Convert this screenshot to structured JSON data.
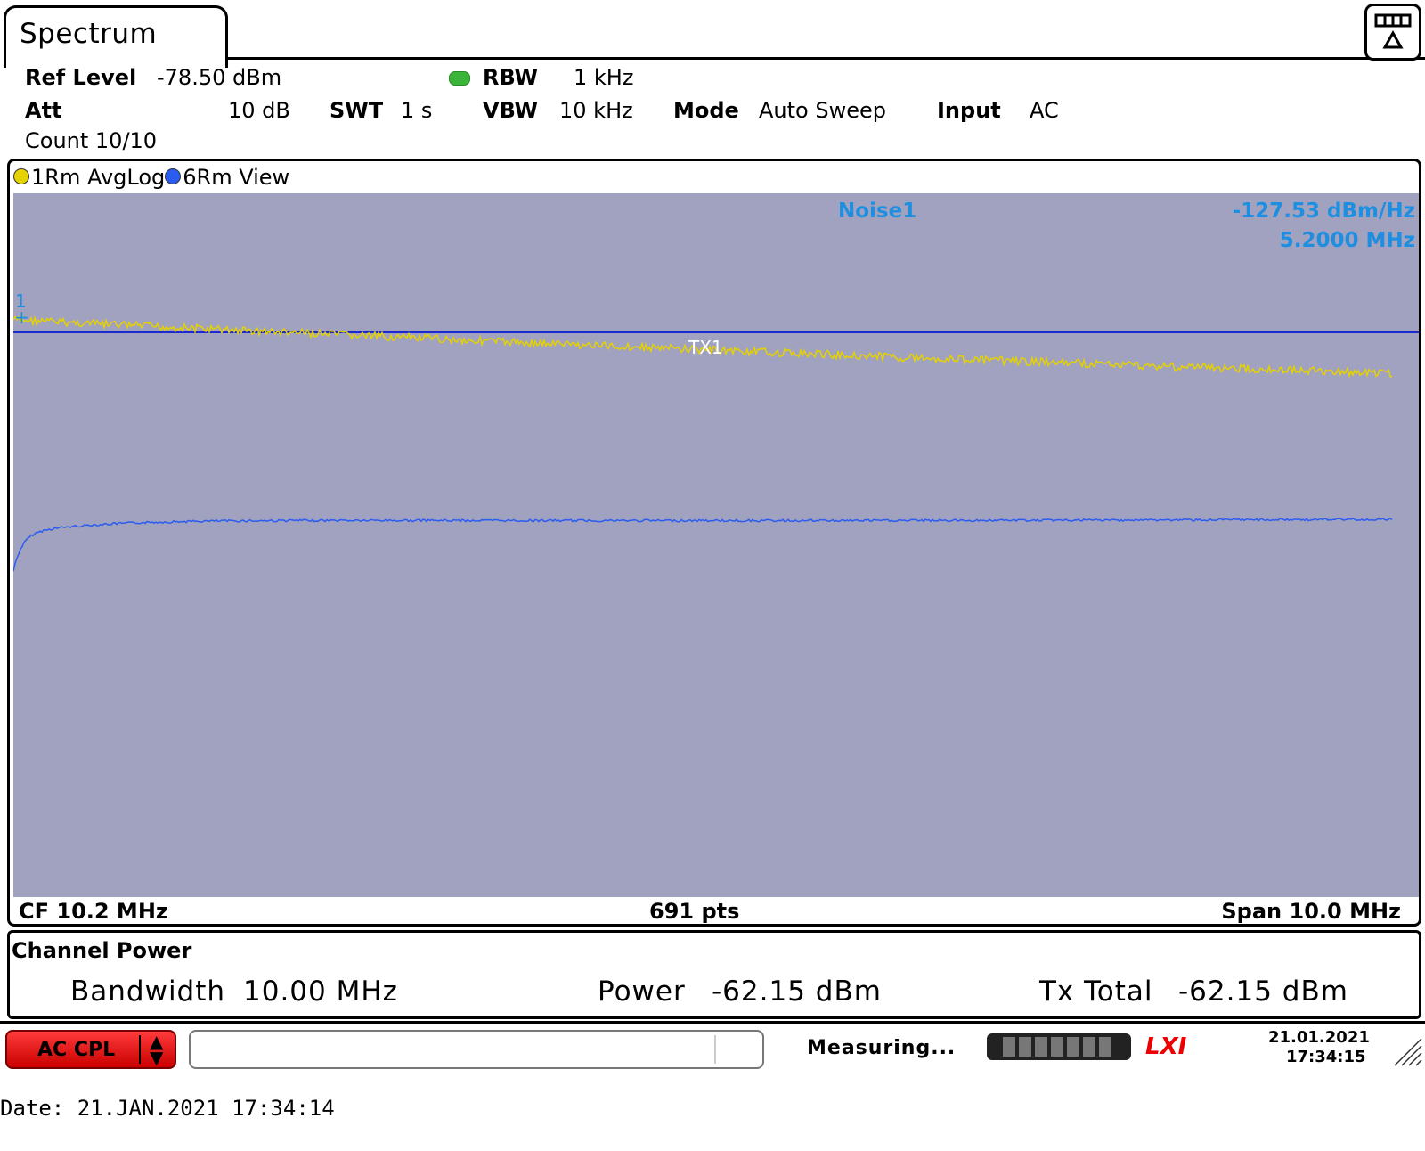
{
  "window": {
    "tab_title": "Spectrum"
  },
  "settings": {
    "ref_level_label": "Ref Level",
    "ref_level_value": "-78.50 dBm",
    "att_label": "Att",
    "att_value": "10 dB",
    "swt_label": "SWT",
    "swt_value": "1 s",
    "rbw_label": "RBW",
    "rbw_value": "1 kHz",
    "vbw_label": "VBW",
    "vbw_value": "10 kHz",
    "mode_label": "Mode",
    "mode_value": "Auto Sweep",
    "input_label": "Input",
    "input_value": "AC",
    "count": "Count 10/10"
  },
  "diagram": {
    "legend": [
      {
        "label": "1Rm AvgLog",
        "color": "#e6d200"
      },
      {
        "label": "6Rm View",
        "color": "#2a5cf0"
      }
    ],
    "marker_label": "Noise1",
    "marker_level": "-127.53 dBm/Hz",
    "marker_freq": "5.2000 MHz",
    "marker_number": "1",
    "channel_label": "TX1",
    "cf": "CF 10.2 MHz",
    "pts": "691 pts",
    "span": "Span 10.0 MHz",
    "colors": {
      "background": "#a0a2c0",
      "trace1": "#e6d200",
      "trace2": "#2a5cf0",
      "line": "#1a2ad0",
      "marker_text": "#1e8fe0"
    }
  },
  "channel_power": {
    "title": "Channel Power",
    "bandwidth_label": "Bandwidth",
    "bandwidth_value": "10.00 MHz",
    "power_label": "Power",
    "power_value": "-62.15 dBm",
    "tx_total_label": "Tx Total",
    "tx_total_value": "-62.15 dBm"
  },
  "status_bar": {
    "ac_cpl_label": "AC CPL",
    "message": "",
    "measuring": "Measuring...",
    "lxi_logo": "LXI",
    "date": "21.01.2021",
    "time": "17:34:15"
  },
  "footer": {
    "date_line": "Date: 21.JAN.2021   17:34:14"
  }
}
